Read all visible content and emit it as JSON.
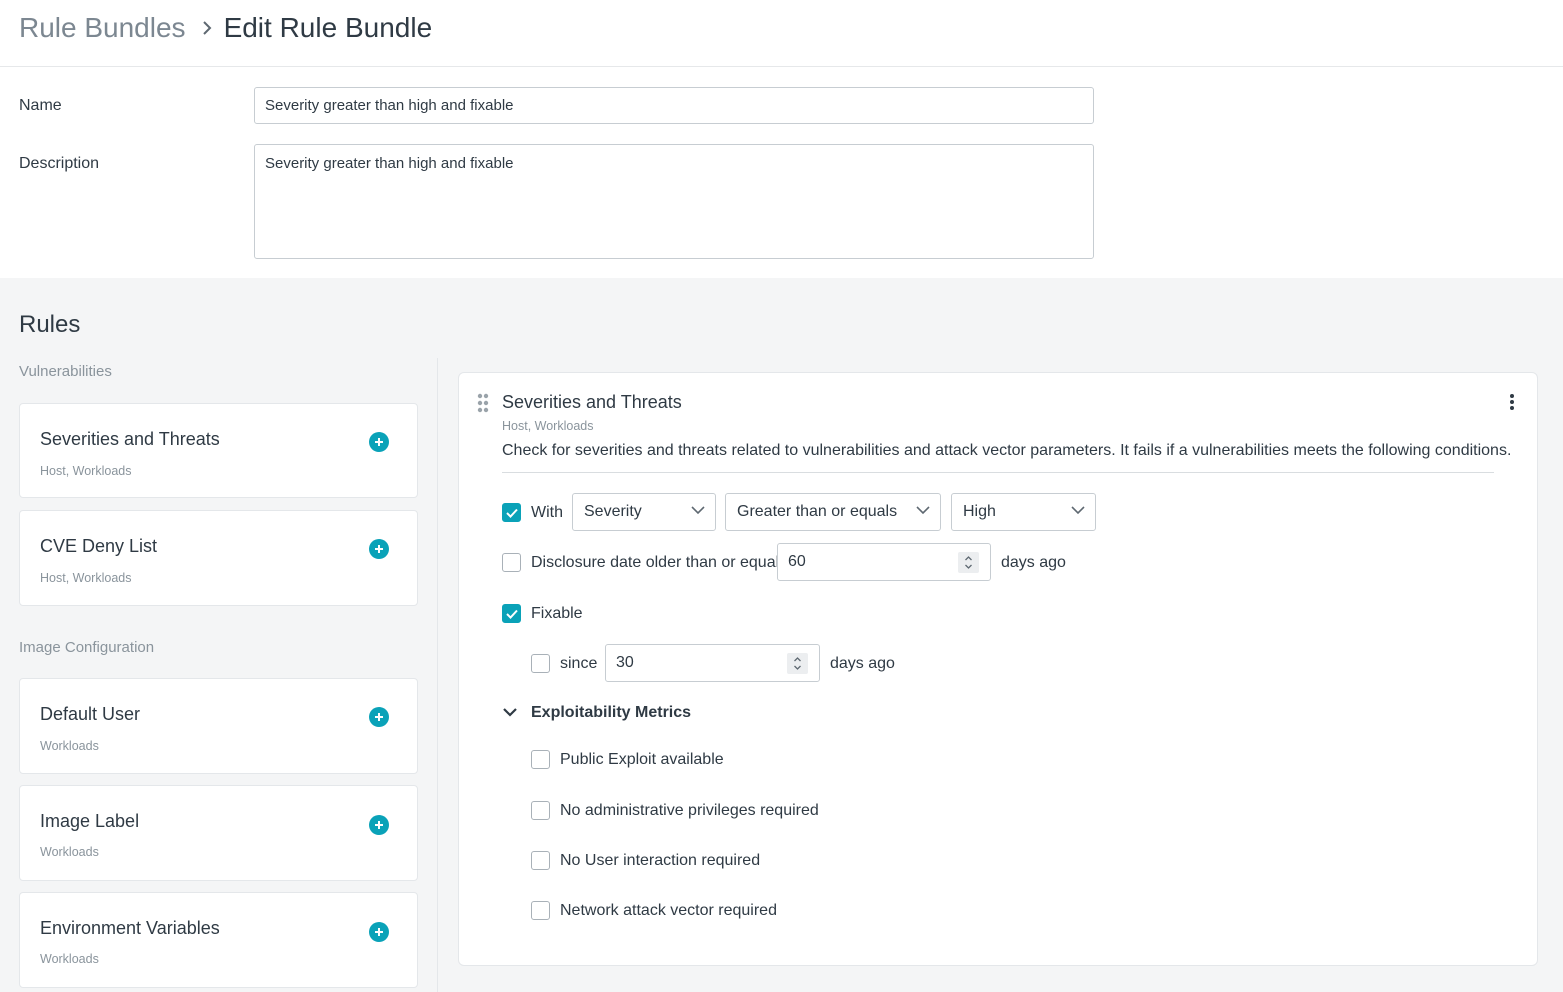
{
  "breadcrumb": {
    "parent": "Rule Bundles",
    "current": "Edit Rule Bundle"
  },
  "form": {
    "name_label": "Name",
    "name_value": "Severity greater than high and fixable",
    "description_label": "Description",
    "description_value": "Severity greater than high and fixable"
  },
  "rules": {
    "title": "Rules",
    "groups": [
      {
        "title": "Vulnerabilities",
        "items": [
          {
            "title": "Severities and Threats",
            "scope": "Host, Workloads"
          },
          {
            "title": "CVE Deny List",
            "scope": "Host, Workloads"
          }
        ]
      },
      {
        "title": "Image Configuration",
        "items": [
          {
            "title": "Default User",
            "scope": "Workloads"
          },
          {
            "title": "Image Label",
            "scope": "Workloads"
          },
          {
            "title": "Environment Variables",
            "scope": "Workloads"
          }
        ]
      }
    ]
  },
  "active_rule": {
    "title": "Severities and Threats",
    "scope": "Host, Workloads",
    "description": "Check for severities and threats related to vulnerabilities and attack vector parameters. It fails if a vulnerabilities meets the following conditions.",
    "with": {
      "label": "With",
      "checked": true,
      "field": "Severity",
      "operator": "Greater than or equals",
      "value": "High"
    },
    "disclosure": {
      "label": "Disclosure date older than or equal",
      "checked": false,
      "value": "60",
      "suffix": "days ago"
    },
    "fixable": {
      "label": "Fixable",
      "checked": true
    },
    "since": {
      "label": "since",
      "checked": false,
      "value": "30",
      "suffix": "days ago"
    },
    "metrics": {
      "title": "Exploitability Metrics",
      "expanded": true,
      "options": [
        {
          "label": "Public Exploit available",
          "checked": false
        },
        {
          "label": "No administrative privileges required",
          "checked": false
        },
        {
          "label": "No User interaction required",
          "checked": false
        },
        {
          "label": "Network attack vector required",
          "checked": false
        }
      ]
    }
  },
  "colors": {
    "accent": "#0aa2b8",
    "text": "#2f3a44",
    "muted": "#8a949c",
    "background": "#f4f5f6"
  }
}
